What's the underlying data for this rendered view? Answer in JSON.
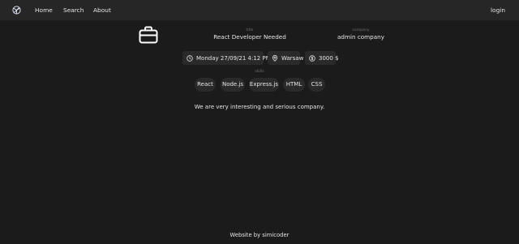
{
  "nav": {
    "home": "Home",
    "search": "Search",
    "about": "About",
    "login": "login"
  },
  "job": {
    "title_caption": "title",
    "title": "React Developer Needed",
    "company_caption": "company",
    "company": "admin company",
    "date": "Monday 27/09/21 4:12 PM",
    "location": "Warsaw",
    "salary": "3000 $",
    "skills_caption": "skills",
    "skills": [
      "React",
      "Node.js",
      "Express.js",
      "HTML",
      "CSS"
    ],
    "description": "We are very interesting and serious company."
  },
  "footer": {
    "text": "Website by simicoder"
  },
  "icons": {
    "logo": "logo-icon",
    "job": "briefcase-icon",
    "date": "clock-icon",
    "location": "map-pin-icon",
    "salary": "dollar-icon"
  },
  "colors": {
    "background": "#1b1b1b",
    "navbar": "#262626",
    "chip": "#2a2a2a",
    "text": "#e6e6e6",
    "caption": "#6f6f6f"
  }
}
